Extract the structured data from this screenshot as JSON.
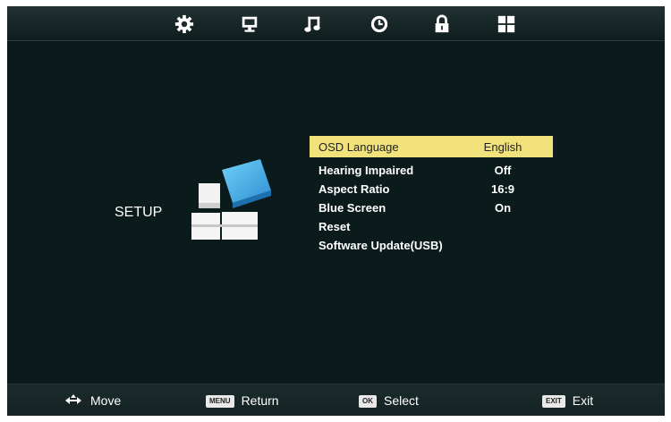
{
  "tabs": [
    {
      "icon": "gear-icon",
      "label": "Setup",
      "active": true
    },
    {
      "icon": "monitor-icon",
      "label": "Picture"
    },
    {
      "icon": "music-note-icon",
      "label": "Sound"
    },
    {
      "icon": "clock-icon",
      "label": "Time"
    },
    {
      "icon": "lock-icon",
      "label": "Lock"
    },
    {
      "icon": "grid-icon",
      "label": "Channel"
    }
  ],
  "section": {
    "label": "SETUP",
    "graphic_icon": "setup-blocks-icon"
  },
  "menu": {
    "items": [
      {
        "label": "OSD Language",
        "value": "English",
        "selected": true
      },
      {
        "label": "Hearing Impaired",
        "value": "Off"
      },
      {
        "label": "Aspect Ratio",
        "value": "16:9"
      },
      {
        "label": "Blue Screen",
        "value": "On"
      },
      {
        "label": "Reset",
        "value": ""
      },
      {
        "label": "Software Update(USB)",
        "value": ""
      }
    ]
  },
  "footer": {
    "move": {
      "label": "Move",
      "icon": "four-way-arrow-icon"
    },
    "return": {
      "key": "MENU",
      "label": "Return"
    },
    "select": {
      "key": "OK",
      "label": "Select"
    },
    "exit": {
      "key": "EXIT",
      "label": "Exit"
    }
  },
  "colors": {
    "background": "#0b1b1c",
    "highlight": "#f2e27c",
    "text": "#ffffff"
  }
}
